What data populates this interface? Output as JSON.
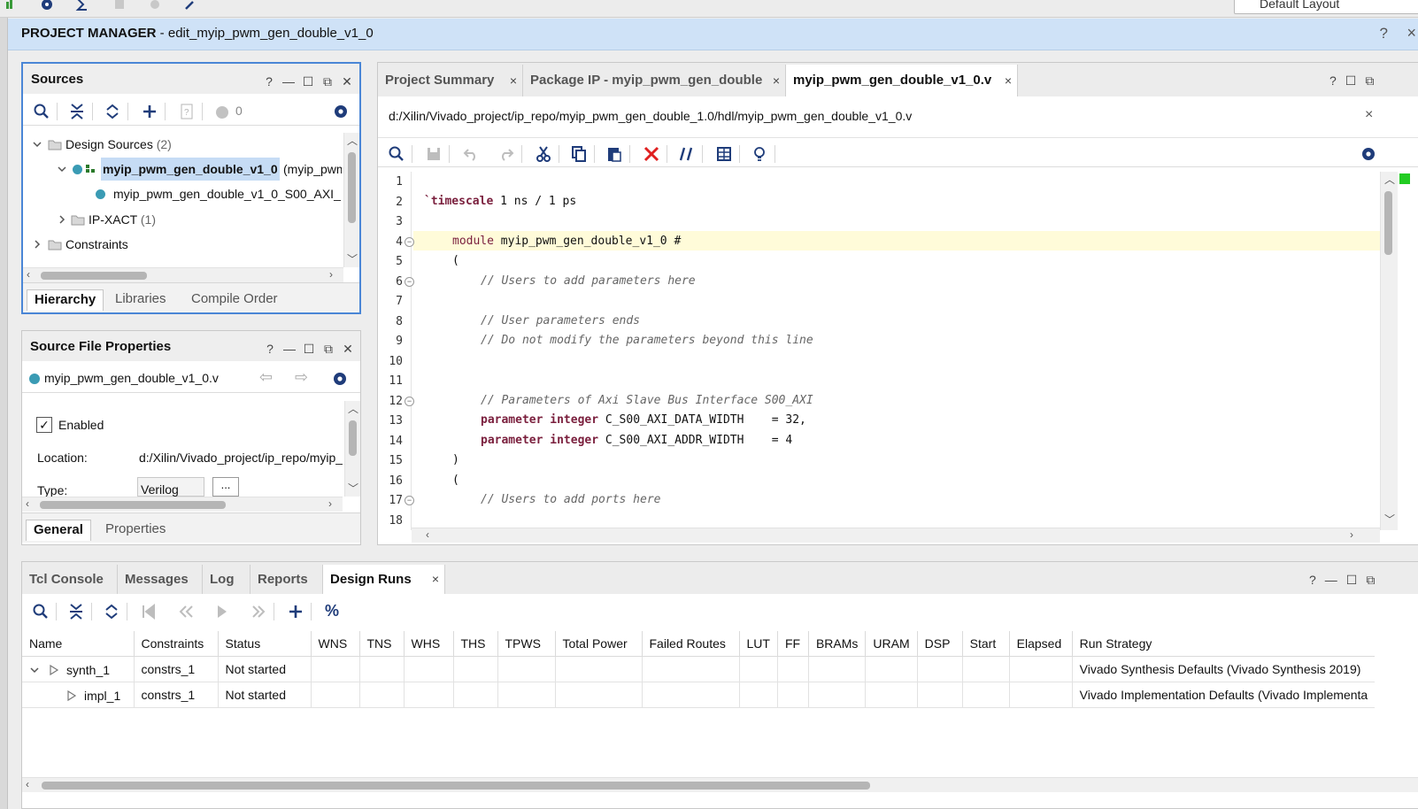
{
  "top": {
    "layout_value": "Default Layout"
  },
  "header": {
    "title_bold": "PROJECT MANAGER",
    "title_rest": " - edit_myip_pwm_gen_double_v1_0"
  },
  "sources": {
    "title": "Sources",
    "status_count": "0",
    "tree": [
      {
        "label": "Design Sources",
        "count": "(2)"
      },
      {
        "label": "myip_pwm_gen_double_v1_0",
        "suffix": "(myip_pwm"
      },
      {
        "label": "myip_pwm_gen_double_v1_0_S00_AXI_"
      },
      {
        "label": "IP-XACT",
        "count": "(1)"
      },
      {
        "label": "Constraints"
      }
    ],
    "tabs": [
      "Hierarchy",
      "Libraries",
      "Compile Order"
    ]
  },
  "file_props": {
    "title": "Source File Properties",
    "file_name": "myip_pwm_gen_double_v1_0.v",
    "enabled_label": "Enabled",
    "location_label": "Location:",
    "location_value": "d:/Xilin/Vivado_project/ip_repo/myip_",
    "type_label": "Type:",
    "type_value": "Verilog",
    "more": "...",
    "tabs": [
      "General",
      "Properties"
    ]
  },
  "editor": {
    "tabs": [
      "Project Summary",
      "Package IP - myip_pwm_gen_double",
      "myip_pwm_gen_double_v1_0.v"
    ],
    "close_glyph": "×",
    "file_path": "d:/Xilin/Vivado_project/ip_repo/myip_pwm_gen_double_1.0/hdl/myip_pwm_gen_double_v1_0.v",
    "line_numbers": [
      "1",
      "2",
      "3",
      "4",
      "5",
      "6",
      "7",
      "8",
      "9",
      "10",
      "11",
      "12",
      "13",
      "14",
      "15",
      "16",
      "17",
      "18"
    ],
    "code": {
      "l2_kw": "`timescale",
      "l2_rest": " 1 ns / 1 ps",
      "l4_kw": "module",
      "l4_rest": " myip_pwm_gen_double_v1_0 #",
      "l5": "(",
      "l6": "// Users to add parameters here",
      "l8": "// User parameters ends",
      "l9": "// Do not modify the parameters beyond this line",
      "l12": "// Parameters of Axi Slave Bus Interface S00_AXI",
      "param_kw": "parameter integer",
      "l13_rest": " C_S00_AXI_DATA_WIDTH    = 32,",
      "l14_rest": " C_S00_AXI_ADDR_WIDTH    = 4",
      "l15": ")",
      "l16": "(",
      "l17": "// Users to add ports here"
    }
  },
  "bottom": {
    "tabs": [
      "Tcl Console",
      "Messages",
      "Log",
      "Reports",
      "Design Runs"
    ],
    "columns": [
      "Name",
      "Constraints",
      "Status",
      "WNS",
      "TNS",
      "WHS",
      "THS",
      "TPWS",
      "Total Power",
      "Failed Routes",
      "LUT",
      "FF",
      "BRAMs",
      "URAM",
      "DSP",
      "Start",
      "Elapsed",
      "Run Strategy"
    ],
    "rows": [
      {
        "name": "synth_1",
        "constraints": "constrs_1",
        "status": "Not started",
        "strategy": "Vivado Synthesis Defaults (Vivado Synthesis 2019)"
      },
      {
        "name": "impl_1",
        "constraints": "constrs_1",
        "status": "Not started",
        "strategy": "Vivado Implementation Defaults (Vivado Implementa"
      }
    ]
  },
  "colors": {
    "accent": "#4a86d6",
    "header_bg": "#cfe2f7",
    "keyword": "#7a1f3d",
    "run_red": "#e02020"
  }
}
